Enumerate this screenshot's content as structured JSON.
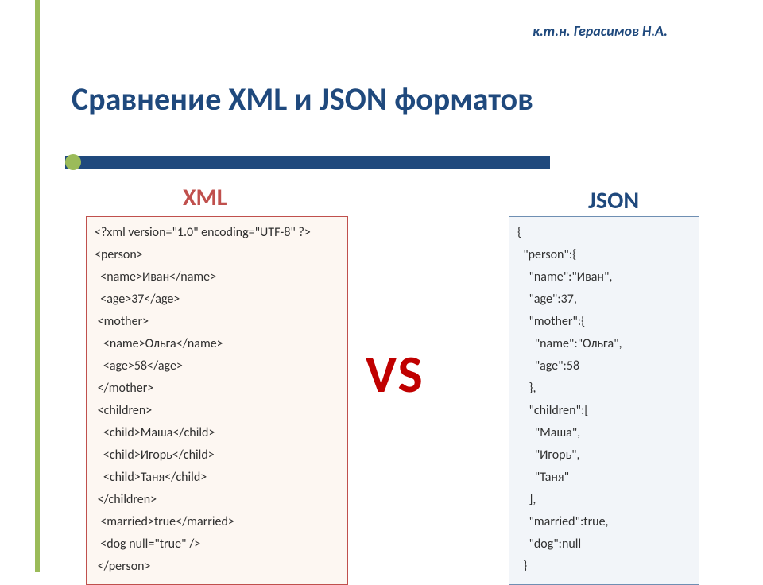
{
  "author": "к.т.н. Герасимов Н.А.",
  "title": "Сравнение XML и JSON форматов",
  "columns": {
    "xml_label": "XML",
    "json_label": "JSON"
  },
  "vs": "VS",
  "xml_code": [
    "<?xml version=\"1.0\" encoding=\"UTF-8\" ?>",
    "<person>",
    "  <name>Иван</name>",
    "  <age>37</age>",
    " <mother>",
    "   <name>Ольга</name>",
    "   <age>58</age>",
    " </mother>",
    " <children>",
    "   <child>Маша</child>",
    "   <child>Игорь</child>",
    "   <child>Таня</child>",
    " </children>",
    "  <married>true</married>",
    "  <dog null=\"true\" />",
    " </person>"
  ],
  "json_code": [
    "{",
    "  \"person\":{",
    "    \"name\":\"Иван\",",
    "    \"age\":37,",
    "    \"mother\":{",
    "      \"name\":\"Ольга\",",
    "      \"age\":58",
    "    },",
    "    \"children\":[",
    "      \"Маша\",",
    "      \"Игорь\",",
    "      \"Таня\"",
    "    ],",
    "    \"married\":true,",
    "    \"dog\":null",
    "  }"
  ]
}
